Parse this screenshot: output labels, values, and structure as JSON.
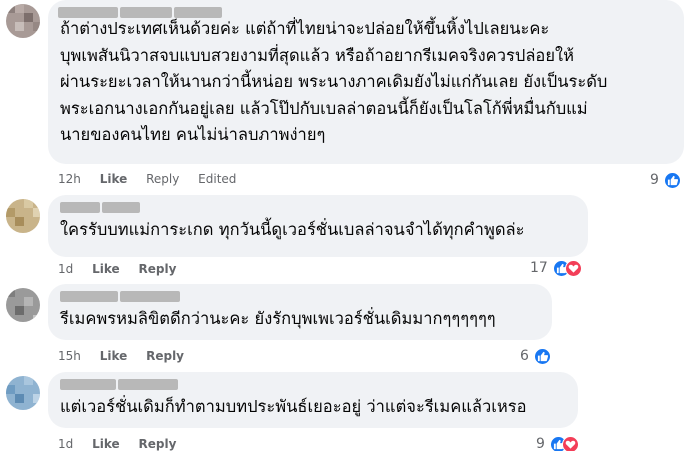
{
  "comments": [
    {
      "text": [
        "ถ้าต่างประเทศเห็นด้วยค่ะ แต่ถ้าที่ไทยน่าจะปล่อยให้ขึ้นหิ้งไปเลยนะคะ",
        "บุพเพสันนิวาสจบแบบสวยงามที่สุดแล้ว หรือถ้าอยากรีเมคจริงควรปล่อยให้",
        "ผ่านระยะเวลาให้นานกว่านี้หน่อย พระนางภาคเดิมยังไม่แก่กันเลย ยังเป็นระดับ",
        "พระเอกนางเอกกันอยู่เลย แล้วโป๊ปกับเบลล่าตอนนี้ก็ยังเป็นโลโก้พี่หมื่นกับแม่",
        "นายของคนไทย คนไม่น่าลบภาพง่ายๆ"
      ],
      "time": "12h",
      "like_label": "Like",
      "reply_label": "Reply",
      "edited_label": "Edited",
      "reaction_count": "9",
      "reactions": [
        "like-icon"
      ]
    },
    {
      "text": [
        "ใครรับบทแม่การะเกด ทุกวันนี้ดูเวอร์ชั่นเบลล่าจนจำได้ทุกคำพูดล่ะ"
      ],
      "time": "1d",
      "like_label": "Like",
      "reply_label": "Reply",
      "reaction_count": "17",
      "reactions": [
        "like-icon",
        "love-icon"
      ]
    },
    {
      "text": [
        "รีเมคพรหมลิขิตดีกว่านะคะ ยังรักบุพเพเวอร์ชั่นเดิมมากๆๆๆๆๆๆ"
      ],
      "time": "15h",
      "like_label": "Like",
      "reply_label": "Reply",
      "reaction_count": "6",
      "reactions": [
        "like-icon"
      ]
    },
    {
      "text": [
        "แต่เวอร์ชั่นเดิมก็ทำตามบทประพันธ์เยอะอยู่ ว่าแต่จะรีเมคแล้วเหรอ"
      ],
      "time": "1d",
      "like_label": "Like",
      "reply_label": "Reply",
      "reaction_count": "9",
      "reactions": [
        "like-icon",
        "love-icon"
      ]
    }
  ],
  "colors": {
    "bubble": "#f0f2f5",
    "meta": "#65676b",
    "like": "#1877f2",
    "love": "#f33e58"
  }
}
